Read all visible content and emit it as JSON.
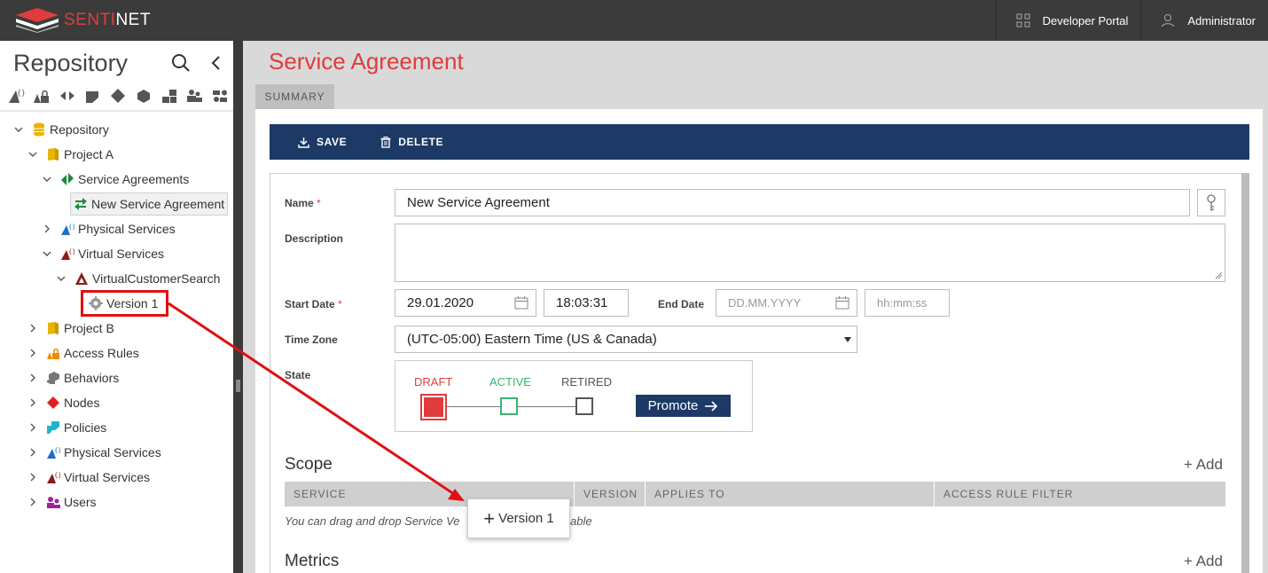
{
  "app": {
    "brand_prefix": "SENTI",
    "brand_suffix": "NET",
    "developer_portal": "Developer Portal",
    "user": "Administrator"
  },
  "sidebar": {
    "title": "Repository",
    "tree": [
      {
        "label": "Repository",
        "icon": "database-icon",
        "color": "#e8b400"
      },
      {
        "label": "Project A",
        "icon": "folder-icon",
        "color": "#e8b400"
      },
      {
        "label": "Service Agreements",
        "icon": "agreement-icon",
        "color": "#1a8a3a"
      },
      {
        "label": "New Service Agreement",
        "icon": "exchange-icon",
        "color": "#1a8a3a"
      },
      {
        "label": "Physical Services",
        "icon": "physical-service-icon",
        "color": "#1f6fc2"
      },
      {
        "label": "Virtual Services",
        "icon": "virtual-service-icon",
        "color": "#8a1a1a"
      },
      {
        "label": "VirtualCustomerSearch",
        "icon": "triangle-icon",
        "color": "#8a1a1a"
      },
      {
        "label": "Version 1",
        "icon": "gear-icon",
        "color": "#999999"
      },
      {
        "label": "Project B",
        "icon": "folder-icon",
        "color": "#e8b400"
      },
      {
        "label": "Access Rules",
        "icon": "lock-icon",
        "color": "#f08a00"
      },
      {
        "label": "Behaviors",
        "icon": "cubes-icon",
        "color": "#777777"
      },
      {
        "label": "Nodes",
        "icon": "diamond-icon",
        "color": "#e02020"
      },
      {
        "label": "Policies",
        "icon": "policy-icon",
        "color": "#1fb5c9"
      },
      {
        "label": "Physical Services",
        "icon": "physical-service-icon",
        "color": "#1f6fc2"
      },
      {
        "label": "Virtual Services",
        "icon": "virtual-service-icon",
        "color": "#8a1a1a"
      },
      {
        "label": "Users",
        "icon": "users-icon",
        "color": "#a020a0"
      }
    ]
  },
  "main": {
    "title": "Service Agreement",
    "tab": "SUMMARY",
    "toolbar": {
      "save": "SAVE",
      "delete": "DELETE"
    },
    "form": {
      "name_label": "Name",
      "name_value": "New Service Agreement",
      "description_label": "Description",
      "start_date_label": "Start Date",
      "start_date": "29.01.2020",
      "start_time": "18:03:31",
      "end_date_label": "End Date",
      "end_date_placeholder": "DD.MM.YYYY",
      "end_time_placeholder": "hh:mm:ss",
      "timezone_label": "Time Zone",
      "timezone_value": "(UTC-05:00) Eastern Time (US & Canada)",
      "state_label": "State",
      "required_mark": "*"
    },
    "state": {
      "draft": "DRAFT",
      "active": "ACTIVE",
      "retired": "RETIRED",
      "promote": "Promote",
      "colors": {
        "draft": "#e03c3c",
        "active": "#3cb371",
        "retired": "#555555"
      }
    },
    "scope": {
      "title": "Scope",
      "add": "+ Add",
      "columns": [
        "SERVICE",
        "VERSION",
        "APPLIES TO",
        "ACCESS RULE FILTER"
      ],
      "hint": "You can drag and drop Service Ve",
      "hint_tail": "able"
    },
    "metrics": {
      "title": "Metrics",
      "add": "+ Add"
    },
    "drag_chip": "Version 1"
  }
}
